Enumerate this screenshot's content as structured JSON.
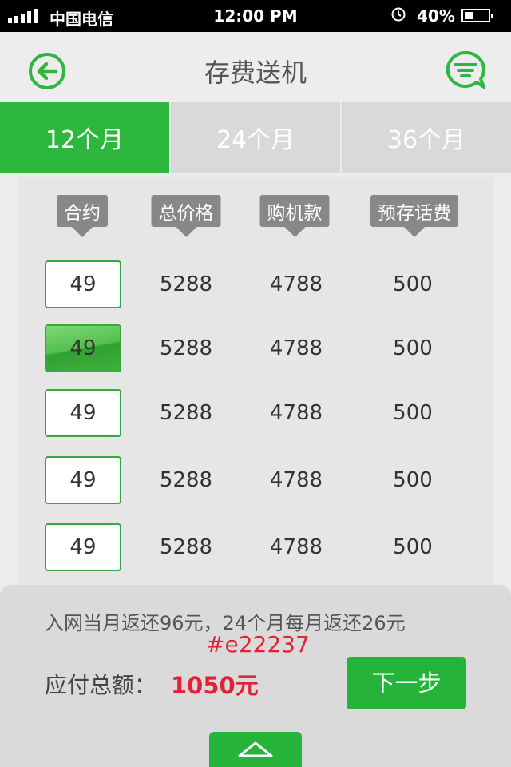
{
  "status_bar": {
    "carrier": "中国电信",
    "time": "12:00 PM",
    "battery_text": "40%",
    "battery_level": 0.4
  },
  "nav": {
    "title": "存费送机",
    "back_icon": "back-arrow-icon",
    "message_icon": "message-icon"
  },
  "tabs": [
    {
      "label": "12个月",
      "active": true
    },
    {
      "label": "24个月",
      "active": false
    },
    {
      "label": "36个月",
      "active": false
    }
  ],
  "table": {
    "headers": [
      "合约",
      "总价格",
      "购机款",
      "预存话费"
    ],
    "rows": [
      {
        "plan": "49",
        "total": "5288",
        "device": "4788",
        "prepay": "500",
        "selected": false
      },
      {
        "plan": "49",
        "total": "5288",
        "device": "4788",
        "prepay": "500",
        "selected": true
      },
      {
        "plan": "49",
        "total": "5288",
        "device": "4788",
        "prepay": "500",
        "selected": false
      },
      {
        "plan": "49",
        "total": "5288",
        "device": "4788",
        "prepay": "500",
        "selected": false
      },
      {
        "plan": "49",
        "total": "5288",
        "device": "4788",
        "prepay": "500",
        "selected": false
      }
    ]
  },
  "bottom": {
    "info": "入网当月返还96元，24个月每月返还26元",
    "hex_note": "#e22237",
    "total_label": "应付总额：",
    "total_value": "1050元",
    "next_label": "下一步",
    "collapse_icon": "chevron-up-icon"
  },
  "colors": {
    "accent": "#2db83d",
    "highlight": "#e22237",
    "header_tag": "#888888"
  }
}
